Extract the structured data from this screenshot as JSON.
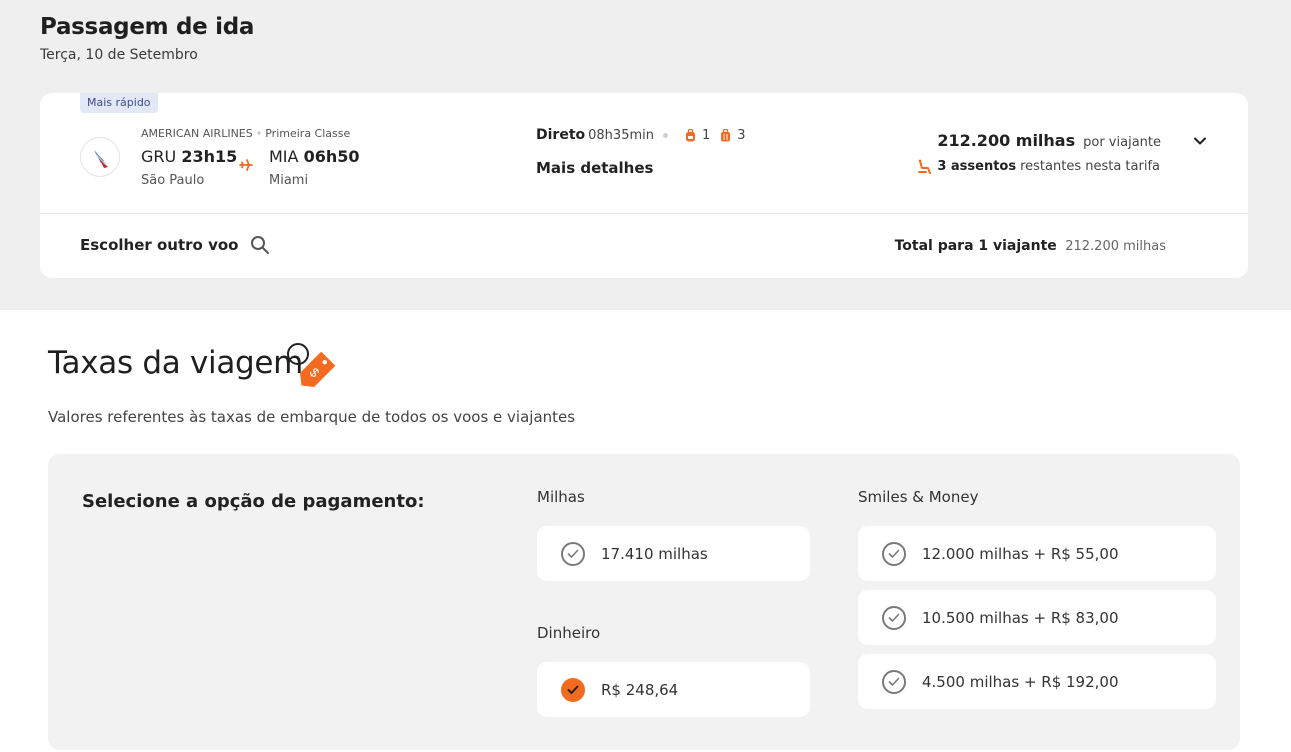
{
  "header": {
    "title": "Passagem de ida",
    "date": "Terça, 10 de Setembro"
  },
  "flight": {
    "badge": "Mais rápido",
    "airline": "AMERICAN AIRLINES",
    "cabin": "Primeira Classe",
    "origin_code": "GRU",
    "origin_time": "23h15",
    "origin_city": "São Paulo",
    "dest_code": "MIA",
    "dest_time": "06h50",
    "dest_city": "Miami",
    "stops_label": "Direto",
    "duration": "08h35min",
    "carry_on_count": "1",
    "checked_bag_count": "3",
    "details_label": "Mais detalhes",
    "price": "212.200 milhas",
    "price_per": "por viajante",
    "seats_bold": "3 assentos",
    "seats_rest": "restantes nesta tarifa",
    "choose_other": "Escolher outro voo",
    "total_label": "Total para 1 viajante",
    "total_value": "212.200 milhas"
  },
  "taxes": {
    "title": "Taxas da viagem",
    "tag_symbol": "$",
    "subtitle": "Valores referentes às taxas de embarque de todos os voos e viajantes",
    "payment_label": "Selecione a opção de pagamento:",
    "miles_label": "Milhas",
    "money_label": "Dinheiro",
    "smiles_money_label": "Smiles & Money",
    "miles_option": "17.410 milhas",
    "money_option": "R$ 248,64",
    "smiles_options": [
      "12.000 milhas + R$ 55,00",
      "10.500 milhas + R$ 83,00",
      "4.500 milhas + R$ 192,00"
    ]
  },
  "colors": {
    "accent": "#f26b21",
    "badge_bg": "#e3e8f6",
    "badge_text": "#3c4a8a"
  }
}
